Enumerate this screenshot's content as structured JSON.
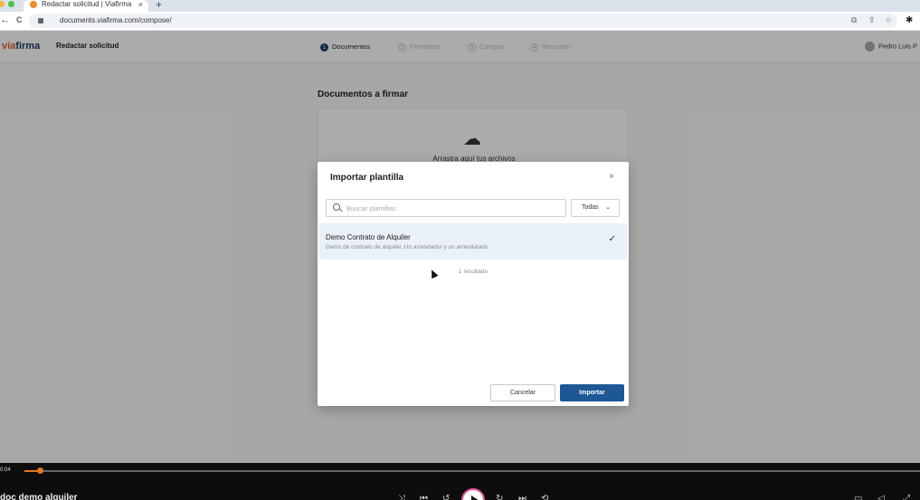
{
  "browser": {
    "tab_title": "Redactar solicitud | Viafirma",
    "tab_close": "×",
    "new_tab": "+",
    "url": "documents.viafirma.com/compose/",
    "back": "←",
    "reload": "C"
  },
  "app": {
    "logo_via": "via",
    "logo_firma": "firma",
    "page_title": "Redactar solicitud",
    "steps": [
      {
        "num": "1",
        "label": "Documentos"
      },
      {
        "num": "2",
        "label": "Firmantes"
      },
      {
        "num": "3",
        "label": "Campos"
      },
      {
        "num": "4",
        "label": "Resumen"
      }
    ],
    "user": "Pedro Luis P",
    "docs_title": "Documentos a firmar",
    "dropzone_text": "Arrastra aquí tus archivos"
  },
  "modal": {
    "title": "Importar plantilla",
    "close": "×",
    "search_placeholder": "Buscar plantillas",
    "filter": "Todas",
    "result": {
      "name": "Demo Contrato de Alquiler",
      "description": "Demo de contrato de alquiler. Un arrendador y un arrendatario",
      "check": "✓"
    },
    "result_count": "1 resultado",
    "cancel": "Cancelar",
    "import": "Importar"
  },
  "player": {
    "time": "0:04",
    "progress_percent": 2,
    "title": "doc demo alquiler"
  },
  "colors": {
    "accent": "#1d5896",
    "brand_orange": "#e0612a",
    "player_progress": "#e8771f"
  }
}
